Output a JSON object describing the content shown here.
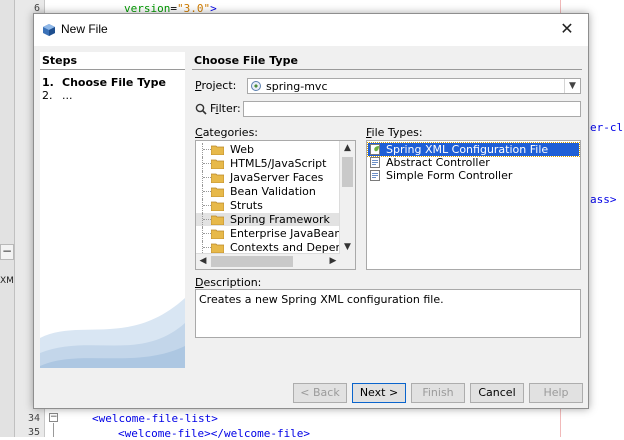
{
  "editor": {
    "line_numbers": [
      "6",
      "34",
      "35"
    ],
    "top_code": {
      "attr": "version",
      "eq": "=",
      "value": "\"3.0\"",
      "close": ">"
    },
    "right_fragments": [
      "er-cl",
      "ass>"
    ],
    "bottom_code": [
      "<welcome-file-list>",
      "<welcome-file></welcome-file>"
    ],
    "left_strip": {
      "button": "−",
      "label": "XML"
    }
  },
  "dialog": {
    "title": "New File",
    "close_glyph": "✕",
    "steps": {
      "heading": "Steps",
      "items": [
        {
          "num": "1.",
          "label": "Choose File Type"
        },
        {
          "num": "2.",
          "label": "..."
        }
      ]
    },
    "pane_title": "Choose File Type",
    "project": {
      "label_u": "P",
      "label_rest": "roject:",
      "value": "spring-mvc"
    },
    "filter": {
      "label_u": "i",
      "label_pre": "F",
      "label_rest": "lter:",
      "value": ""
    },
    "categories": {
      "label_u": "C",
      "label_rest": "ategories:",
      "items": [
        "Web",
        "HTML5/JavaScript",
        "JavaServer Faces",
        "Bean Validation",
        "Struts",
        "Spring Framework",
        "Enterprise JavaBeans",
        "Contexts and Dependency Injection"
      ],
      "selected": "Spring Framework"
    },
    "file_types": {
      "label_u": "F",
      "label_rest": "ile Types:",
      "items": [
        "Spring XML Configuration File",
        "Abstract Controller",
        "Simple Form Controller"
      ],
      "selected": "Spring XML Configuration File"
    },
    "description": {
      "label_u": "D",
      "label_rest": "escription:",
      "text": "Creates a new Spring XML configuration file."
    },
    "buttons": {
      "back": "< Back",
      "next": "Next >",
      "finish": "Finish",
      "cancel": "Cancel",
      "help": "Help"
    }
  }
}
